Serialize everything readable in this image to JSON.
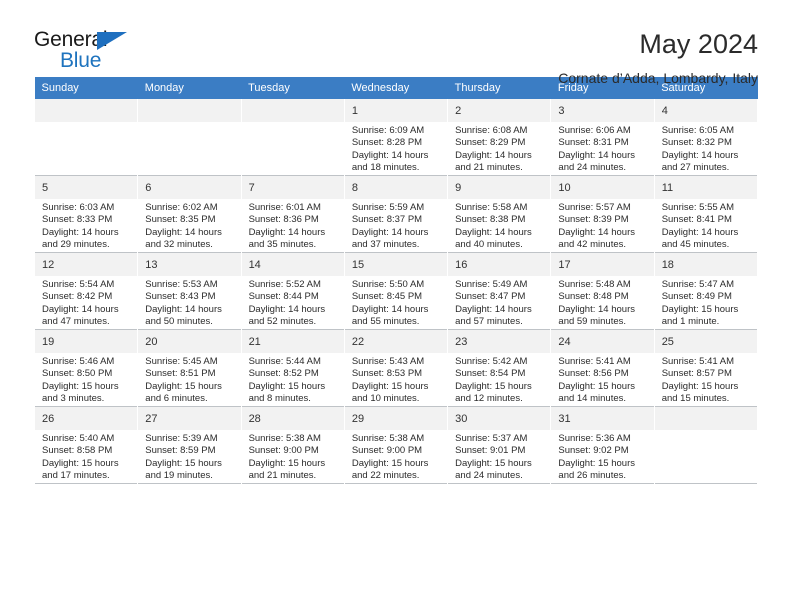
{
  "brand": {
    "word_one": "General",
    "word_two": "Blue",
    "triangle_icon": "triangle-icon",
    "accent_color": "#1e73be"
  },
  "header": {
    "title": "May 2024",
    "location": "Cornate d’Adda, Lombardy, Italy"
  },
  "calendar": {
    "header_bg": "#3b7dc4",
    "weekdays": [
      "Sunday",
      "Monday",
      "Tuesday",
      "Wednesday",
      "Thursday",
      "Friday",
      "Saturday"
    ],
    "weeks": [
      [
        {
          "day": "",
          "lines": []
        },
        {
          "day": "",
          "lines": []
        },
        {
          "day": "",
          "lines": []
        },
        {
          "day": "1",
          "lines": [
            "Sunrise: 6:09 AM",
            "Sunset: 8:28 PM",
            "Daylight: 14 hours",
            "and 18 minutes."
          ]
        },
        {
          "day": "2",
          "lines": [
            "Sunrise: 6:08 AM",
            "Sunset: 8:29 PM",
            "Daylight: 14 hours",
            "and 21 minutes."
          ]
        },
        {
          "day": "3",
          "lines": [
            "Sunrise: 6:06 AM",
            "Sunset: 8:31 PM",
            "Daylight: 14 hours",
            "and 24 minutes."
          ]
        },
        {
          "day": "4",
          "lines": [
            "Sunrise: 6:05 AM",
            "Sunset: 8:32 PM",
            "Daylight: 14 hours",
            "and 27 minutes."
          ]
        }
      ],
      [
        {
          "day": "5",
          "lines": [
            "Sunrise: 6:03 AM",
            "Sunset: 8:33 PM",
            "Daylight: 14 hours",
            "and 29 minutes."
          ]
        },
        {
          "day": "6",
          "lines": [
            "Sunrise: 6:02 AM",
            "Sunset: 8:35 PM",
            "Daylight: 14 hours",
            "and 32 minutes."
          ]
        },
        {
          "day": "7",
          "lines": [
            "Sunrise: 6:01 AM",
            "Sunset: 8:36 PM",
            "Daylight: 14 hours",
            "and 35 minutes."
          ]
        },
        {
          "day": "8",
          "lines": [
            "Sunrise: 5:59 AM",
            "Sunset: 8:37 PM",
            "Daylight: 14 hours",
            "and 37 minutes."
          ]
        },
        {
          "day": "9",
          "lines": [
            "Sunrise: 5:58 AM",
            "Sunset: 8:38 PM",
            "Daylight: 14 hours",
            "and 40 minutes."
          ]
        },
        {
          "day": "10",
          "lines": [
            "Sunrise: 5:57 AM",
            "Sunset: 8:39 PM",
            "Daylight: 14 hours",
            "and 42 minutes."
          ]
        },
        {
          "day": "11",
          "lines": [
            "Sunrise: 5:55 AM",
            "Sunset: 8:41 PM",
            "Daylight: 14 hours",
            "and 45 minutes."
          ]
        }
      ],
      [
        {
          "day": "12",
          "lines": [
            "Sunrise: 5:54 AM",
            "Sunset: 8:42 PM",
            "Daylight: 14 hours",
            "and 47 minutes."
          ]
        },
        {
          "day": "13",
          "lines": [
            "Sunrise: 5:53 AM",
            "Sunset: 8:43 PM",
            "Daylight: 14 hours",
            "and 50 minutes."
          ]
        },
        {
          "day": "14",
          "lines": [
            "Sunrise: 5:52 AM",
            "Sunset: 8:44 PM",
            "Daylight: 14 hours",
            "and 52 minutes."
          ]
        },
        {
          "day": "15",
          "lines": [
            "Sunrise: 5:50 AM",
            "Sunset: 8:45 PM",
            "Daylight: 14 hours",
            "and 55 minutes."
          ]
        },
        {
          "day": "16",
          "lines": [
            "Sunrise: 5:49 AM",
            "Sunset: 8:47 PM",
            "Daylight: 14 hours",
            "and 57 minutes."
          ]
        },
        {
          "day": "17",
          "lines": [
            "Sunrise: 5:48 AM",
            "Sunset: 8:48 PM",
            "Daylight: 14 hours",
            "and 59 minutes."
          ]
        },
        {
          "day": "18",
          "lines": [
            "Sunrise: 5:47 AM",
            "Sunset: 8:49 PM",
            "Daylight: 15 hours",
            "and 1 minute."
          ]
        }
      ],
      [
        {
          "day": "19",
          "lines": [
            "Sunrise: 5:46 AM",
            "Sunset: 8:50 PM",
            "Daylight: 15 hours",
            "and 3 minutes."
          ]
        },
        {
          "day": "20",
          "lines": [
            "Sunrise: 5:45 AM",
            "Sunset: 8:51 PM",
            "Daylight: 15 hours",
            "and 6 minutes."
          ]
        },
        {
          "day": "21",
          "lines": [
            "Sunrise: 5:44 AM",
            "Sunset: 8:52 PM",
            "Daylight: 15 hours",
            "and 8 minutes."
          ]
        },
        {
          "day": "22",
          "lines": [
            "Sunrise: 5:43 AM",
            "Sunset: 8:53 PM",
            "Daylight: 15 hours",
            "and 10 minutes."
          ]
        },
        {
          "day": "23",
          "lines": [
            "Sunrise: 5:42 AM",
            "Sunset: 8:54 PM",
            "Daylight: 15 hours",
            "and 12 minutes."
          ]
        },
        {
          "day": "24",
          "lines": [
            "Sunrise: 5:41 AM",
            "Sunset: 8:56 PM",
            "Daylight: 15 hours",
            "and 14 minutes."
          ]
        },
        {
          "day": "25",
          "lines": [
            "Sunrise: 5:41 AM",
            "Sunset: 8:57 PM",
            "Daylight: 15 hours",
            "and 15 minutes."
          ]
        }
      ],
      [
        {
          "day": "26",
          "lines": [
            "Sunrise: 5:40 AM",
            "Sunset: 8:58 PM",
            "Daylight: 15 hours",
            "and 17 minutes."
          ]
        },
        {
          "day": "27",
          "lines": [
            "Sunrise: 5:39 AM",
            "Sunset: 8:59 PM",
            "Daylight: 15 hours",
            "and 19 minutes."
          ]
        },
        {
          "day": "28",
          "lines": [
            "Sunrise: 5:38 AM",
            "Sunset: 9:00 PM",
            "Daylight: 15 hours",
            "and 21 minutes."
          ]
        },
        {
          "day": "29",
          "lines": [
            "Sunrise: 5:38 AM",
            "Sunset: 9:00 PM",
            "Daylight: 15 hours",
            "and 22 minutes."
          ]
        },
        {
          "day": "30",
          "lines": [
            "Sunrise: 5:37 AM",
            "Sunset: 9:01 PM",
            "Daylight: 15 hours",
            "and 24 minutes."
          ]
        },
        {
          "day": "31",
          "lines": [
            "Sunrise: 5:36 AM",
            "Sunset: 9:02 PM",
            "Daylight: 15 hours",
            "and 26 minutes."
          ]
        },
        {
          "day": "",
          "lines": []
        }
      ]
    ]
  }
}
